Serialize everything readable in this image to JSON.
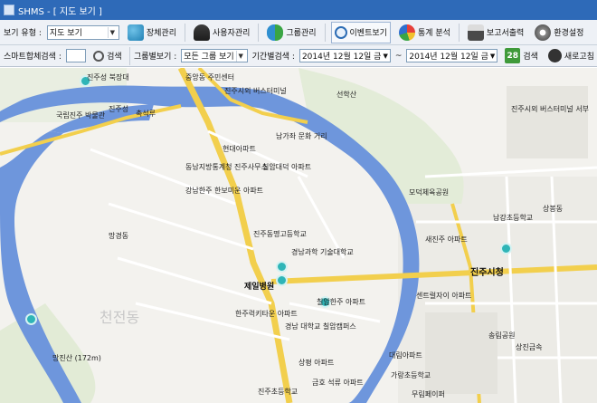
{
  "window": {
    "title": "SHMS - [ 지도 보기 ]"
  },
  "toolbar1": {
    "view_type_label": "보기 유형 :",
    "view_type_value": "지도 보기",
    "buttons": [
      {
        "label": "장체관리",
        "icon": "facility-icon"
      },
      {
        "label": "사용자관리",
        "icon": "user-icon"
      },
      {
        "label": "그룹관리",
        "icon": "group-icon"
      },
      {
        "label": "이벤트보기",
        "icon": "magnifier-icon"
      },
      {
        "label": "통계 분석",
        "icon": "pie-chart-icon"
      },
      {
        "label": "보고서출력",
        "icon": "printer-icon"
      },
      {
        "label": "환경설정",
        "icon": "gear-icon"
      }
    ]
  },
  "toolbar2": {
    "smart_search_label": "스마트합체검색 :",
    "smart_search_value": "",
    "search_label": "검색",
    "group_view_label": "그룹별보기 :",
    "group_value": "모든 그룹 보기",
    "period_label": "기간별검색 :",
    "date_from": "2014년 12월 12일 금",
    "tilde": "~",
    "date_to": "2014년 12월 12일 금",
    "calendar_day": "28",
    "search2_label": "검색",
    "refresh_label": "새로고침"
  },
  "map": {
    "labels": [
      "진주시청",
      "제일병원",
      "경남과학 기술대학교",
      "경남 대학교 칠암캠퍼스",
      "진주시외 버스터미널",
      "선학산",
      "진주성",
      "국립진주 박물관",
      "촉석루",
      "중앙동 주민센터",
      "동남지방통계청 진주사무소",
      "망경동",
      "천전동",
      "망진산 (172m)",
      "모덕체육공원",
      "진주성 북장대",
      "현대아파트",
      "남가좌 문화 거리",
      "칠암대덕 아파트",
      "강남한주 한보미운 아파트",
      "진주동명고등학교",
      "칠암한주 아파트",
      "한주럭키타운 아파트",
      "상평 아파트",
      "송림공원",
      "상진금속",
      "센트럴자이 아파트",
      "새진주 아파트",
      "대림아파트",
      "가랑초등학교",
      "무림페이퍼",
      "상봉동",
      "남강초등학교",
      "진주시외 버스터미널 서부",
      "금호 석류 아파트",
      "진주초등학교"
    ],
    "markers": [
      {
        "type": "sensor"
      },
      {
        "type": "sensor"
      },
      {
        "type": "sensor"
      },
      {
        "type": "sensor"
      },
      {
        "type": "sensor"
      },
      {
        "type": "sensor"
      }
    ]
  }
}
